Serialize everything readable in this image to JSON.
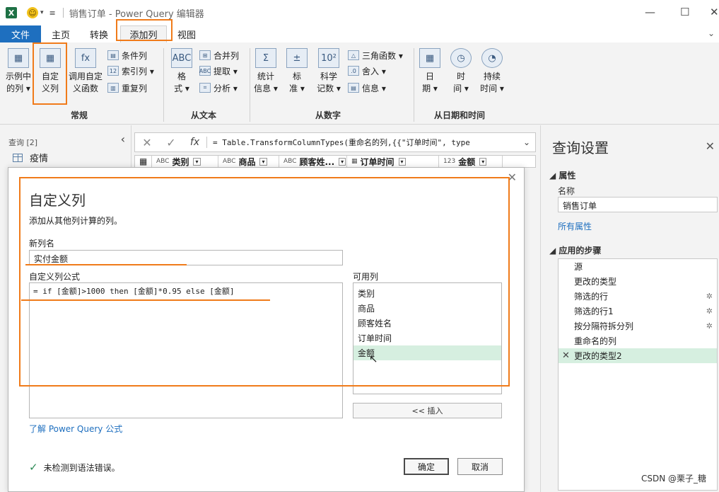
{
  "window": {
    "title": "销售订单 - Power Query 编辑器",
    "excel_icon": "X",
    "controls": [
      "—",
      "☐",
      "✕"
    ]
  },
  "tabs": [
    "文件",
    "主页",
    "转换",
    "添加列",
    "视图"
  ],
  "ribbon": {
    "changgui": {
      "label": "常规",
      "example": [
        "示例中",
        "的列 ▾"
      ],
      "custom": [
        "自定",
        "义列"
      ],
      "invoke": [
        "调用自定",
        "义函数"
      ],
      "conditional": "条件列",
      "index": "索引列 ▾",
      "duplicate": "重复列"
    },
    "fromtext": {
      "label": "从文本",
      "format": [
        "格",
        "式 ▾"
      ],
      "merge": "合并列",
      "extract": "提取 ▾",
      "parse": "分析 ▾"
    },
    "fromnumber": {
      "label": "从数字",
      "stats": [
        "统计",
        "信息 ▾"
      ],
      "standard": [
        "标",
        "准 ▾"
      ],
      "scientific": [
        "科学",
        "记数 ▾"
      ],
      "trig": "三角函数 ▾",
      "rounding": "舍入 ▾",
      "info": "信息 ▾"
    },
    "fromdatetime": {
      "label": "从日期和时间",
      "date": [
        "日",
        "期 ▾"
      ],
      "time": [
        "时",
        "间 ▾"
      ],
      "duration": [
        "持续",
        "时间 ▾"
      ]
    }
  },
  "queries": {
    "header": "查询 [2]",
    "items": [
      "疫情"
    ]
  },
  "formula_bar": {
    "cancel": "✕",
    "confirm": "✓",
    "fx": "fx",
    "text": "= Table.TransformColumnTypes(重命名的列,{{\"订单时间\", type"
  },
  "columns": [
    {
      "type": "ABC",
      "name": "类别"
    },
    {
      "type": "ABC",
      "name": "商品"
    },
    {
      "type": "ABC",
      "name": "顾客姓..."
    },
    {
      "type": "▦",
      "name": "订单时间"
    },
    {
      "type": "123",
      "name": "金额"
    }
  ],
  "settings": {
    "title": "查询设置",
    "properties_header": "属性",
    "name_label": "名称",
    "name_value": "销售订单",
    "all_props": "所有属性",
    "steps_header": "应用的步骤",
    "steps": [
      {
        "name": "源",
        "gear": false
      },
      {
        "name": "更改的类型",
        "gear": false
      },
      {
        "name": "筛选的行",
        "gear": true
      },
      {
        "name": "筛选的行1",
        "gear": true
      },
      {
        "name": "按分隔符拆分列",
        "gear": true
      },
      {
        "name": "重命名的列",
        "gear": false
      },
      {
        "name": "更改的类型2",
        "gear": false,
        "selected": true
      }
    ]
  },
  "dialog": {
    "title": "自定义列",
    "description": "添加从其他列计算的列。",
    "newname_label": "新列名",
    "newname_value": "实付金额",
    "formula_label": "自定义列公式",
    "formula_value": "= if [金额]>1000 then [金额]*0.95 else [金额]",
    "available_label": "可用列",
    "available": [
      "类别",
      "商品",
      "顾客姓名",
      "订单时间",
      "金额"
    ],
    "insert": "<< 插入",
    "learn_link": "了解 Power Query 公式",
    "status": "未检测到语法错误。",
    "ok": "确定",
    "cancel": "取消"
  },
  "watermark": "CSDN @栗子_糖",
  "colors": {
    "accent": "#1e6fbf",
    "annotation": "#f07b1a",
    "selection": "#d6efe0"
  }
}
